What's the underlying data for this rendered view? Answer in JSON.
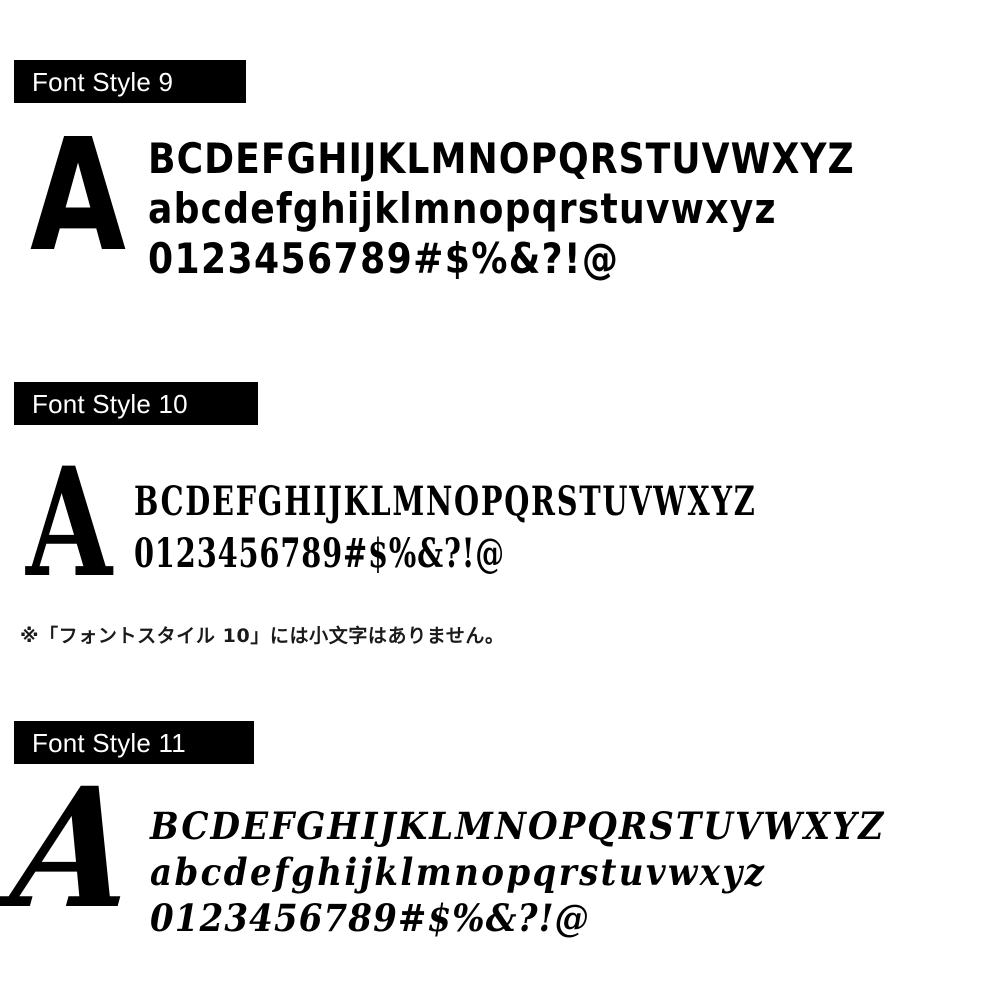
{
  "page": {
    "background_color": "#ffffff",
    "text_color": "#000000",
    "label_bar_color": "#000000",
    "label_text_color": "#ffffff"
  },
  "sections": [
    {
      "label": "Font Style 9",
      "big_letter": "A",
      "rows": [
        "BCDEFGHIJKLMNOPQRSTUVWXYZ",
        "abcdefghijklmnopqrstuvwxyz",
        "0123456789#$%&?!@"
      ]
    },
    {
      "label": "Font Style 10",
      "big_letter": "A",
      "rows": [
        "BCDEFGHIJKLMNOPQRSTUVWXYZ",
        "0123456789#$%&?!@"
      ],
      "note": "※「フォントスタイル 10」には小文字はありません。"
    },
    {
      "label": "Font Style 11",
      "big_letter": "A",
      "rows": [
        "BCDEFGHIJKLMNOPQRSTUVWXYZ",
        "abcdefghijklmnopqrstuvwxyz",
        "0123456789#$%&?!@"
      ]
    }
  ]
}
